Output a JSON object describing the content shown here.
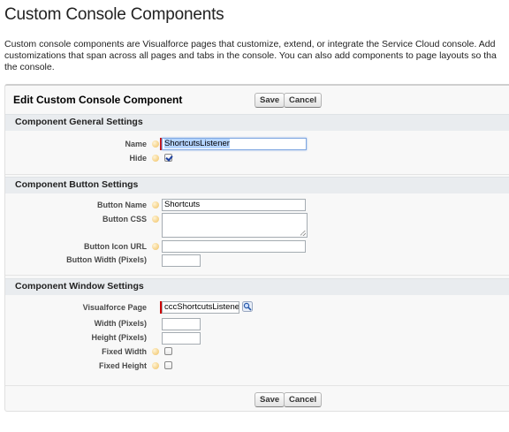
{
  "page": {
    "title": "Custom Console Components",
    "intro_line1": "Custom console components are Visualforce pages that customize, extend, or integrate the Service Cloud console. Add",
    "intro_line2": "customizations that span across all pages and tabs in the console. You can also add components to page layouts so tha",
    "intro_line3": "the console."
  },
  "form": {
    "title": "Edit Custom Console Component",
    "save_label": "Save",
    "cancel_label": "Cancel"
  },
  "general": {
    "heading": "Component General Settings",
    "name_label": "Name",
    "name_value": "ShortcutsListener",
    "hide_label": "Hide",
    "hide_checked": true
  },
  "button": {
    "heading": "Component Button Settings",
    "name_label": "Button Name",
    "name_value": "Shortcuts",
    "css_label": "Button CSS",
    "css_value": "",
    "icon_url_label": "Button Icon URL",
    "icon_url_value": "",
    "width_label": "Button Width (Pixels)",
    "width_value": ""
  },
  "window": {
    "heading": "Component Window Settings",
    "vf_label": "Visualforce Page",
    "vf_value": "cccShortcutsListene",
    "width_label": "Width (Pixels)",
    "width_value": "",
    "height_label": "Height (Pixels)",
    "height_value": "",
    "fixed_width_label": "Fixed Width",
    "fixed_width_checked": false,
    "fixed_height_label": "Fixed Height",
    "fixed_height_checked": false
  },
  "icons": {
    "help": "help-bubble-icon",
    "lookup": "lookup-magnifier-icon"
  },
  "colors": {
    "required_bar": "#cc0000",
    "section_bg": "#e9ecef",
    "panel_bg": "#f8f8f8"
  }
}
